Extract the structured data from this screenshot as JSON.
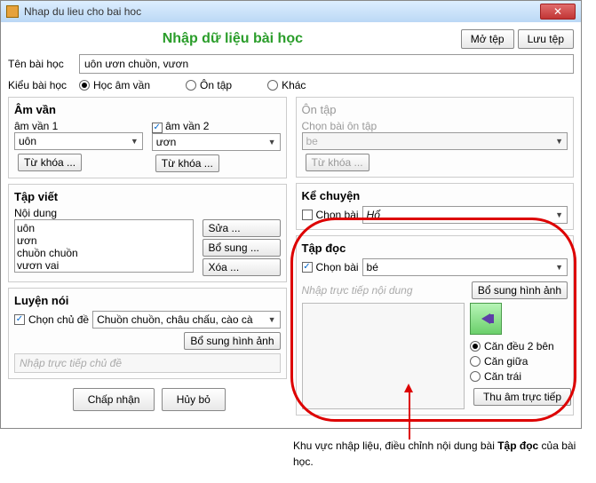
{
  "window": {
    "title": "Nhap du lieu cho bai hoc"
  },
  "main_title": "Nhập dữ liệu bài học",
  "buttons": {
    "open": "Mở tệp",
    "save": "Lưu tệp",
    "keyword": "Từ khóa ...",
    "edit": "Sửa ...",
    "add": "Bổ sung ...",
    "delete": "Xóa ...",
    "add_image": "Bổ sung hình ảnh",
    "accept": "Chấp nhận",
    "cancel": "Hủy bỏ",
    "record": "Thu âm trực tiếp"
  },
  "labels": {
    "lesson_name": "Tên bài học",
    "lesson_type": "Kiểu bài học",
    "am_van": "Âm vần",
    "am_van1": "âm vần 1",
    "am_van2": "âm vần 2",
    "on_tap": "Ôn tập",
    "chon_bai_ontap": "Chọn bài ôn tập",
    "tap_viet": "Tập viết",
    "noi_dung": "Nội dung",
    "luyen_noi": "Luyện nói",
    "chon_chu_de": "Chọn chủ đề",
    "nhap_chu_de": "Nhập trực tiếp chủ đề",
    "ke_chuyen": "Kể chuyện",
    "chon_bai": "Chọn bài",
    "tap_doc": "Tập đọc",
    "nhap_noi_dung": "Nhập trực tiếp nội dung",
    "align_both": "Căn đều 2 bên",
    "align_center": "Căn giữa",
    "align_left": "Căn trái"
  },
  "values": {
    "lesson_name": "uôn ươn chuồn, vươn",
    "type_hoc_am_van": "Học âm vần",
    "type_on_tap": "Ôn tập",
    "type_khac": "Khác",
    "am_van1": "uôn",
    "am_van2": "ươn",
    "ontap_value": "be",
    "chu_de": "Chuồn chuồn, châu chấu, cào cà",
    "ke_chuyen": "Hổ",
    "tap_doc": "bé"
  },
  "tap_viet_items": [
    "uôn",
    "ươn",
    "chuồn chuồn",
    "vươn vai"
  ],
  "annotation": {
    "prefix": "Khu vực nhập liệu, điều chỉnh nội dung bài ",
    "bold": "Tập đọc",
    "suffix": " của bài học."
  }
}
